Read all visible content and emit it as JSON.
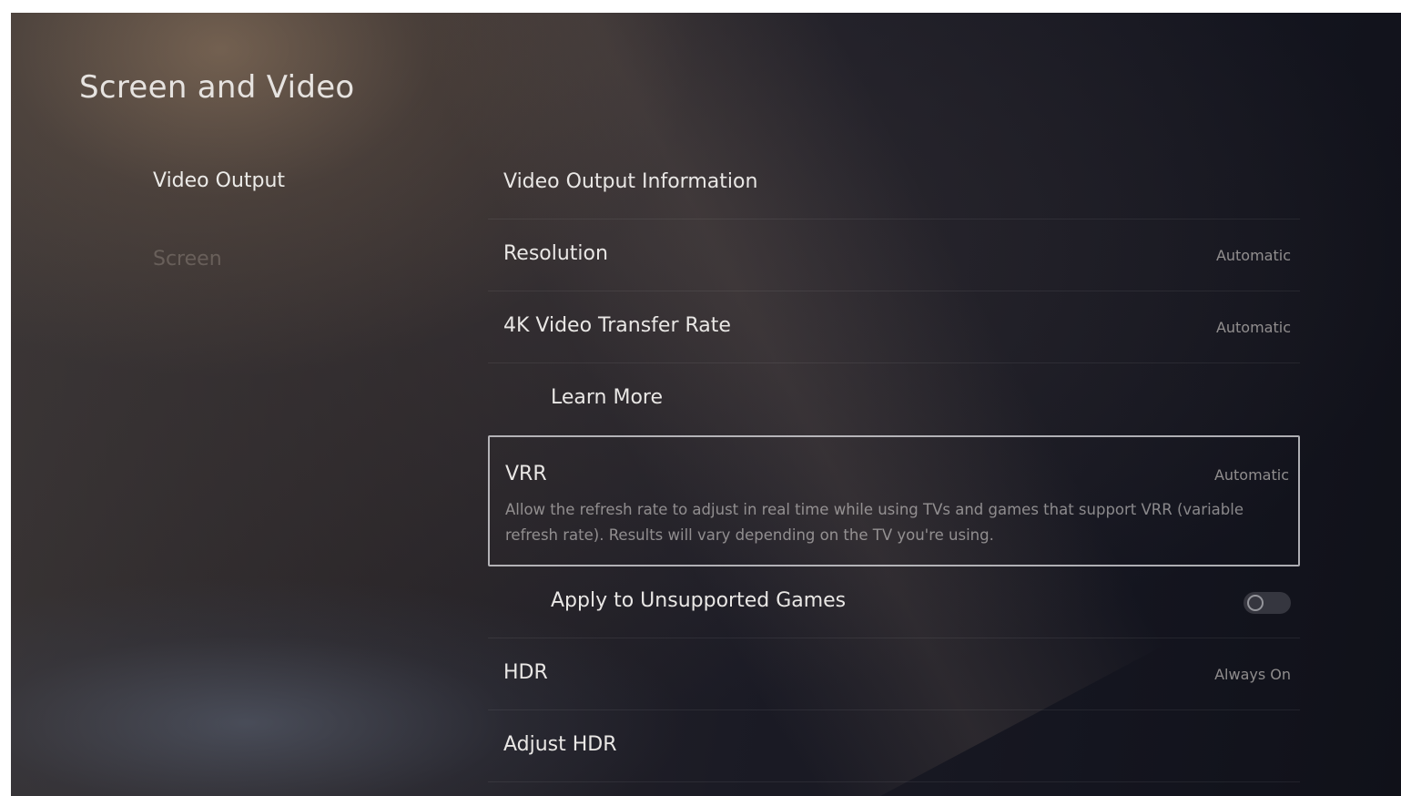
{
  "page": {
    "title": "Screen and Video"
  },
  "sidebar": {
    "items": [
      {
        "label": "Video Output",
        "active": true
      },
      {
        "label": "Screen",
        "active": false
      }
    ]
  },
  "settings": {
    "video_output_information": {
      "label": "Video Output Information"
    },
    "resolution": {
      "label": "Resolution",
      "value": "Automatic"
    },
    "transfer_rate": {
      "label": "4K Video Transfer Rate",
      "value": "Automatic"
    },
    "learn_more": {
      "label": "Learn More"
    },
    "vrr": {
      "label": "VRR",
      "value": "Automatic",
      "description": "Allow the refresh rate to adjust in real time while using TVs and games that support VRR (variable refresh rate). Results will vary depending on the TV you're using."
    },
    "apply_unsupported": {
      "label": "Apply to Unsupported Games",
      "toggle_on": false
    },
    "hdr": {
      "label": "HDR",
      "value": "Always On"
    },
    "adjust_hdr": {
      "label": "Adjust HDR"
    }
  }
}
